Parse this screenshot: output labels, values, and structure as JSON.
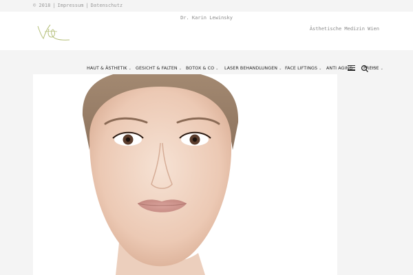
{
  "topbar": {
    "copyright": "© 2018",
    "links": [
      "Impressum",
      "Datenschutz"
    ]
  },
  "header": {
    "site_name": "Dr. Karin Lewinsky",
    "tagline": "Ästhetische Medizin Wien",
    "logo_icon": "signature-logo"
  },
  "nav": {
    "items": [
      {
        "label": "HAUT & ÄSTHETIK",
        "dropdown": true
      },
      {
        "label": "GESICHT & FALTEN",
        "dropdown": true
      },
      {
        "label": "BOTOX & CO",
        "dropdown": true
      },
      {
        "label": "LASER BEHANDLUNGEN",
        "dropdown": true
      },
      {
        "label": "FACE LIFTINGS",
        "dropdown": true
      },
      {
        "label": "ANTI AGING",
        "dropdown": false
      },
      {
        "label": "PREISE",
        "dropdown": true
      }
    ],
    "menu_icon": "hamburger-icon",
    "search_icon": "search-icon",
    "search_label": "suche"
  },
  "hero": {
    "image": "woman-face-portrait"
  },
  "colors": {
    "background": "#f4f4f4",
    "header": "#ffffff",
    "logo": "#b5bf7a",
    "nav_text": "#222222",
    "muted_text": "#8a8a8a"
  }
}
